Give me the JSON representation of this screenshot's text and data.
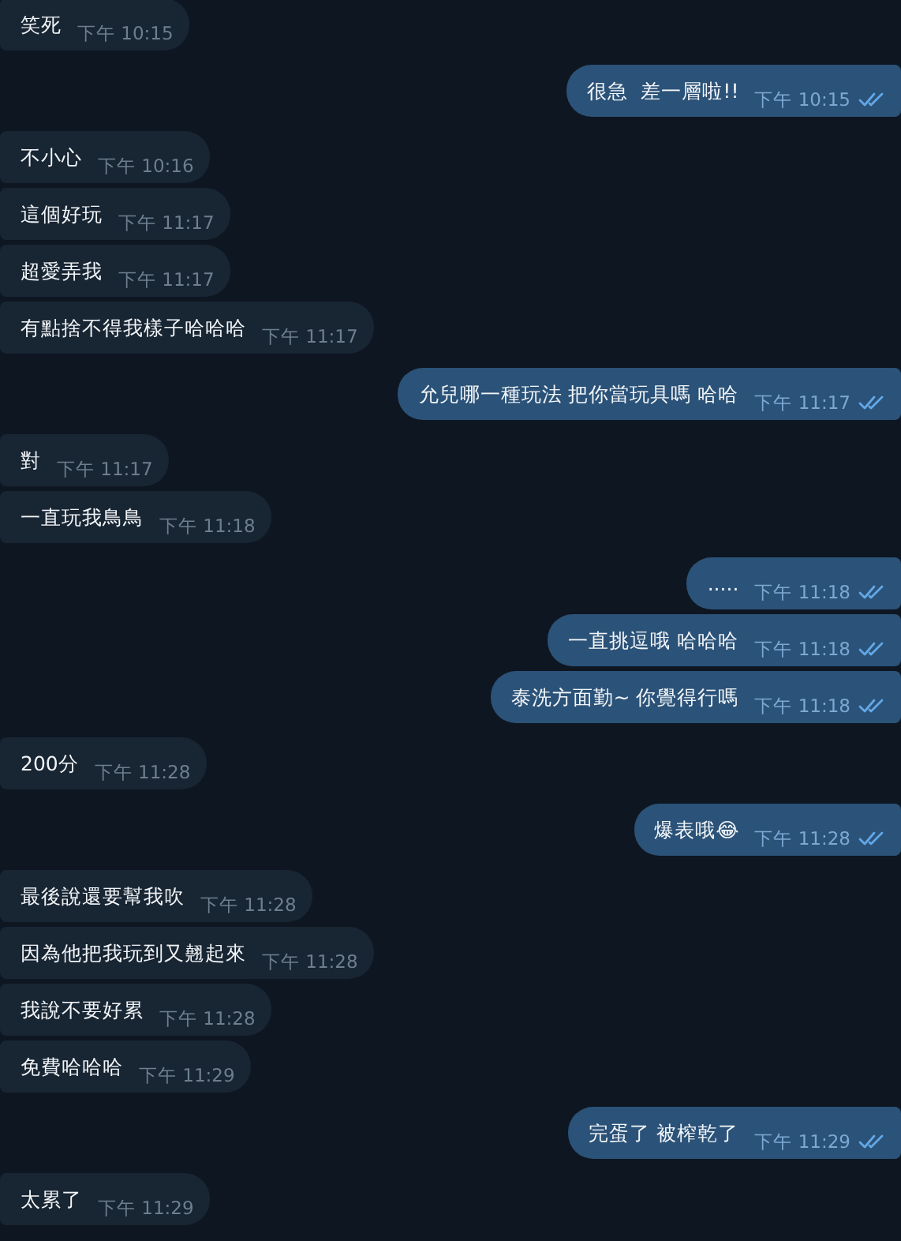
{
  "messages": [
    {
      "kind": "in",
      "text": "笑死",
      "time": "下午 10:15"
    },
    {
      "kind": "out",
      "text": "很急  差一層啦!!",
      "time": "下午 10:15",
      "read": true
    },
    {
      "kind": "in",
      "text": "不小心",
      "time": "下午 10:16"
    },
    {
      "kind": "in",
      "text": "這個好玩",
      "time": "下午 11:17"
    },
    {
      "kind": "in",
      "text": "超愛弄我",
      "time": "下午 11:17"
    },
    {
      "kind": "in",
      "text": "有點捨不得我樣子哈哈哈",
      "time": "下午 11:17"
    },
    {
      "kind": "out",
      "text": "允兒哪一種玩法 把你當玩具嗎 哈哈",
      "time": "下午 11:17",
      "read": true
    },
    {
      "kind": "in",
      "text": "對",
      "time": "下午 11:17"
    },
    {
      "kind": "in",
      "text": "一直玩我鳥鳥",
      "time": "下午 11:18"
    },
    {
      "kind": "out",
      "text": ".....",
      "time": "下午 11:18",
      "read": true
    },
    {
      "kind": "out",
      "text": "一直挑逗哦 哈哈哈",
      "time": "下午 11:18",
      "read": true
    },
    {
      "kind": "out",
      "text": "泰洗方面勤~ 你覺得行嗎",
      "time": "下午 11:18",
      "read": true
    },
    {
      "kind": "in",
      "text": "200分",
      "time": "下午 11:28"
    },
    {
      "kind": "out",
      "text": "爆表哦😂",
      "time": "下午 11:28",
      "read": true
    },
    {
      "kind": "in",
      "text": "最後說還要幫我吹",
      "time": "下午 11:28"
    },
    {
      "kind": "in",
      "text": "因為他把我玩到又翹起來",
      "time": "下午 11:28"
    },
    {
      "kind": "in",
      "text": "我說不要好累",
      "time": "下午 11:28"
    },
    {
      "kind": "in",
      "text": "免費哈哈哈",
      "time": "下午 11:29"
    },
    {
      "kind": "out",
      "text": "完蛋了 被榨乾了",
      "time": "下午 11:29",
      "read": true
    },
    {
      "kind": "in",
      "text": "太累了",
      "time": "下午 11:29"
    }
  ]
}
